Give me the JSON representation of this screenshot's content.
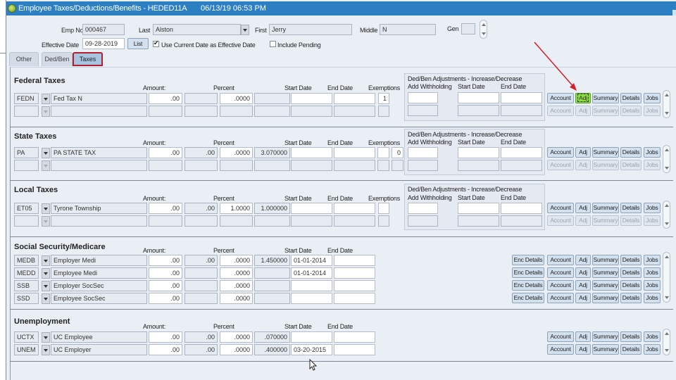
{
  "window": {
    "title": "Employee Taxes/Deductions/Benefits - HEDED11A",
    "datetime": "06/13/19  06:53 PM"
  },
  "header": {
    "emp_no_label": "Emp No",
    "emp_no": "000467",
    "last_label": "Last",
    "last": "Alston",
    "first_label": "First",
    "first": "Jerry",
    "middle_label": "Middle",
    "middle": "N",
    "gen_label": "Gen",
    "gen": "",
    "effective_date_label": "Effective Date",
    "effective_date": "09-28-2019",
    "list_button": "List",
    "use_current_date_label": "Use Current Date as Effective Date",
    "use_current_date_checked": true,
    "include_pending_label": "Include Pending",
    "include_pending_checked": false
  },
  "tabs": [
    {
      "label": "Other",
      "active": false
    },
    {
      "label": "Ded/Ben",
      "active": false
    },
    {
      "label": "Taxes",
      "active": true
    }
  ],
  "column_labels": {
    "amount": "Amount:",
    "percent": "Percent",
    "start_date": "Start Date",
    "end_date": "End Date",
    "exemptions": "Exemptions"
  },
  "adjustments": {
    "title": "Ded/Ben Adjustments - Increase/Decrease",
    "add_withholding": "Add Withholding",
    "start_date": "Start Date",
    "end_date": "End Date"
  },
  "buttons": {
    "enc_details": "Enc Details",
    "account": "Account",
    "adj": "Adj",
    "summary": "Summary",
    "details": "Details",
    "jobs": "Jobs"
  },
  "sections": {
    "federal": {
      "title": "Federal Taxes",
      "rows": [
        {
          "code": "FEDN",
          "desc": "Fed Tax N",
          "amount": ".00",
          "amount2": "",
          "percent": ".0000",
          "rate": "",
          "start": "",
          "end": "",
          "exemptions": "1"
        }
      ]
    },
    "state": {
      "title": "State Taxes",
      "rows": [
        {
          "code": "PA",
          "desc": "PA STATE TAX",
          "amount": ".00",
          "amount2": ".00",
          "percent": ".0000",
          "rate": "3.070000",
          "start": "",
          "end": "",
          "exemptions_a": "",
          "exemptions": "0"
        }
      ]
    },
    "local": {
      "title": "Local Taxes",
      "rows": [
        {
          "code": "ET05",
          "desc": "Tyrone Township",
          "amount": ".00",
          "amount2": ".00",
          "percent": "1.0000",
          "rate": "1.000000",
          "start": "",
          "end": "",
          "exemptions": ""
        }
      ]
    },
    "social": {
      "title": "Social Security/Medicare",
      "rows": [
        {
          "code": "MEDB",
          "desc": "Employer Medi",
          "amount": ".00",
          "amount2": ".00",
          "percent": ".0000",
          "rate": "1.450000",
          "start": "01-01-2014",
          "end": ""
        },
        {
          "code": "MEDD",
          "desc": "Employee Medi",
          "amount": ".00",
          "amount2": "",
          "percent": ".0000",
          "rate": "",
          "start": "01-01-2014",
          "end": ""
        },
        {
          "code": "SSB",
          "desc": "Employer SocSec",
          "amount": ".00",
          "amount2": "",
          "percent": ".0000",
          "rate": "",
          "start": "",
          "end": ""
        },
        {
          "code": "SSD",
          "desc": "Employee SocSec",
          "amount": ".00",
          "amount2": "",
          "percent": ".0000",
          "rate": "",
          "start": "",
          "end": ""
        }
      ]
    },
    "unemployment": {
      "title": "Unemployment",
      "rows": [
        {
          "code": "UCTX",
          "desc": "UC Employee",
          "amount": ".00",
          "amount2": ".00",
          "percent": ".0000",
          "rate": ".070000",
          "start": "",
          "end": ""
        },
        {
          "code": "UNEM",
          "desc": "UC Employer",
          "amount": ".00",
          "amount2": ".00",
          "percent": ".0000",
          "rate": ".400000",
          "start": "03-20-2015",
          "end": ""
        }
      ]
    }
  },
  "colors": {
    "titlebar": "#2d7fc4",
    "highlight_button": "#8ae03c",
    "annotation_arrow": "#d0202a",
    "active_tab_outline": "#b02030"
  }
}
